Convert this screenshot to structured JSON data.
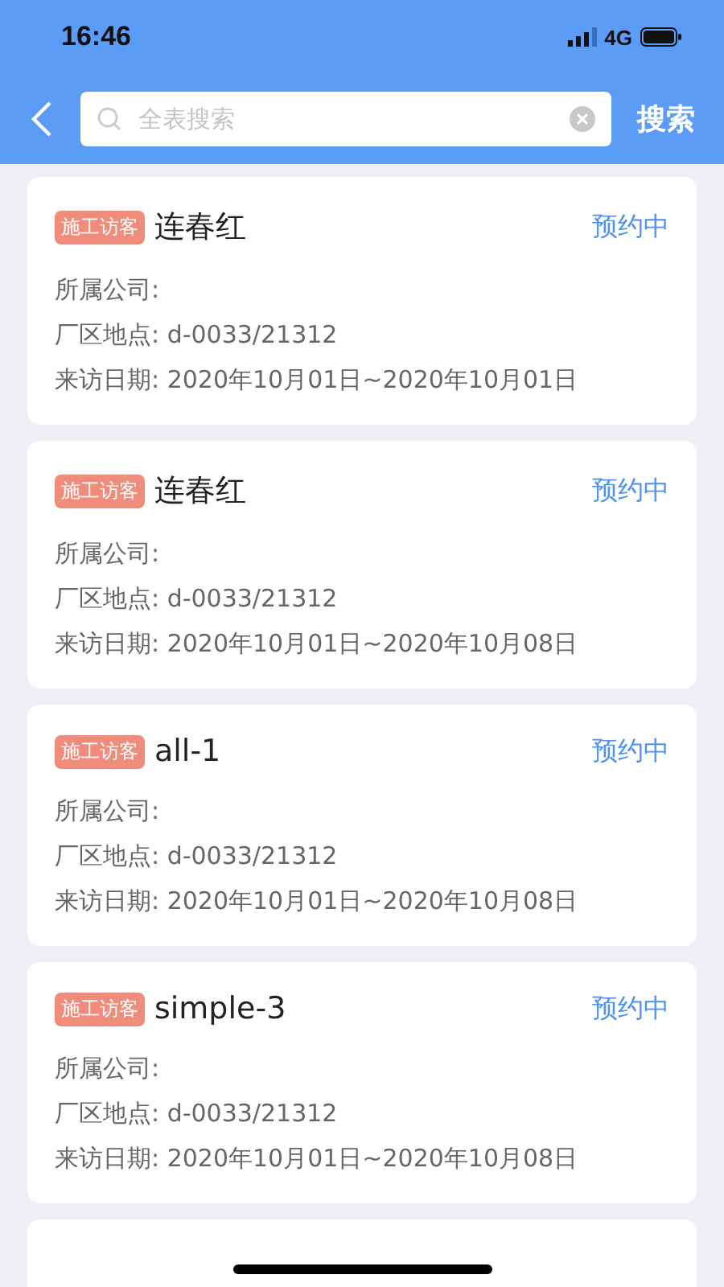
{
  "status_bar": {
    "time": "16:46",
    "network": "4G"
  },
  "header": {
    "search": {
      "placeholder": "全表搜索"
    },
    "search_button": "搜索"
  },
  "cards": [
    {
      "tag": "施工访客",
      "name": "连春红",
      "status": "预约中",
      "company": "所属公司:",
      "location": "厂区地点: d-0033/21312",
      "dates": "来访日期: 2020年10月01日~2020年10月01日"
    },
    {
      "tag": "施工访客",
      "name": "连春红",
      "status": "预约中",
      "company": "所属公司:",
      "location": "厂区地点: d-0033/21312",
      "dates": "来访日期: 2020年10月01日~2020年10月08日"
    },
    {
      "tag": "施工访客",
      "name": "all-1",
      "status": "预约中",
      "company": "所属公司:",
      "location": "厂区地点: d-0033/21312",
      "dates": "来访日期: 2020年10月01日~2020年10月08日"
    },
    {
      "tag": "施工访客",
      "name": "simple-3",
      "status": "预约中",
      "company": "所属公司:",
      "location": "厂区地点: d-0033/21312",
      "dates": "来访日期: 2020年10月01日~2020年10月08日"
    }
  ]
}
